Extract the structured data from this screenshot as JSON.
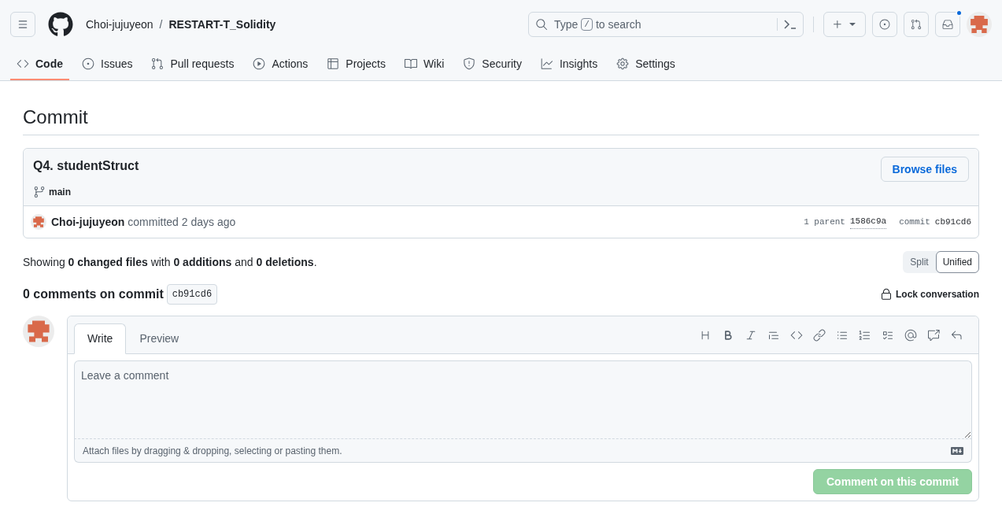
{
  "header": {
    "owner": "Choi-jujuyeon",
    "separator": "/",
    "repo": "RESTART-T_Solidity",
    "search": {
      "before": "Type",
      "key": "/",
      "after": "to search"
    },
    "has_unread": true
  },
  "tabs": [
    {
      "kind": "code",
      "label": "Code",
      "selected": true
    },
    {
      "kind": "issues",
      "label": "Issues",
      "selected": false
    },
    {
      "kind": "pulls",
      "label": "Pull requests",
      "selected": false
    },
    {
      "kind": "actions",
      "label": "Actions",
      "selected": false
    },
    {
      "kind": "projects",
      "label": "Projects",
      "selected": false
    },
    {
      "kind": "wiki",
      "label": "Wiki",
      "selected": false
    },
    {
      "kind": "security",
      "label": "Security",
      "selected": false
    },
    {
      "kind": "insights",
      "label": "Insights",
      "selected": false
    },
    {
      "kind": "settings",
      "label": "Settings",
      "selected": false
    }
  ],
  "page_title": "Commit",
  "commit": {
    "title": "Q4. studentStruct",
    "browse_button": "Browse files",
    "branch": "main",
    "author": "Choi-jujuyeon",
    "action": "committed 2 days ago",
    "parent_label": "1 parent",
    "parent_sha": "1586c9a",
    "commit_label": "commit",
    "sha": "cb91cd6"
  },
  "summary": "Showing **0 changed files** with **0 additions** and **0 deletions**.",
  "view_toggle": [
    {
      "label": "Split",
      "selected": false
    },
    {
      "label": "Unified",
      "selected": true
    }
  ],
  "comments": {
    "heading": "0 comments on commit",
    "sha": "cb91cd6",
    "lock": "Lock conversation"
  },
  "editor": {
    "tabs": [
      {
        "label": "Write",
        "selected": true
      },
      {
        "label": "Preview",
        "selected": false
      }
    ],
    "placeholder": "Leave a comment",
    "attach_hint": "Attach files by dragging & dropping, selecting or pasting them.",
    "submit": {
      "label": "Comment on this commit",
      "disabled": true
    }
  }
}
